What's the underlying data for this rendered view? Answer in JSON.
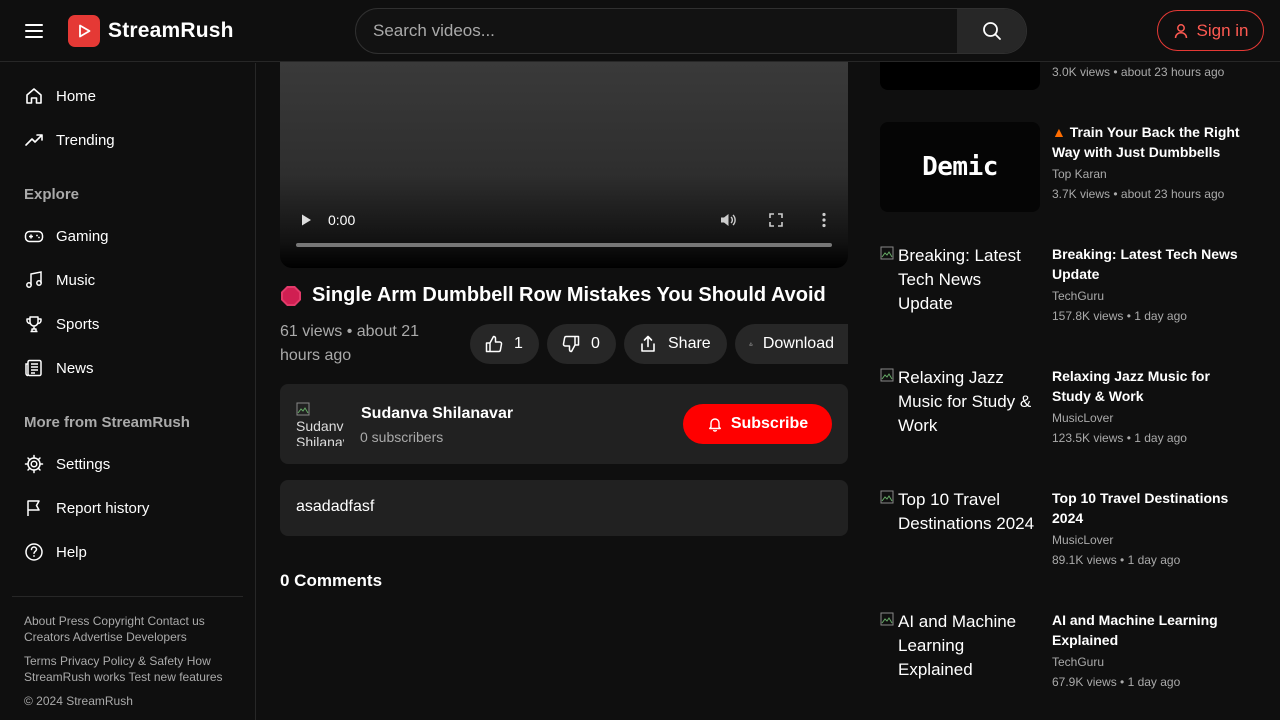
{
  "header": {
    "logo_text": "StreamRush",
    "search_placeholder": "Search videos...",
    "signin_label": "Sign in"
  },
  "sidebar": {
    "primary": [
      {
        "label": "Home",
        "icon": "home-icon"
      },
      {
        "label": "Trending",
        "icon": "trending-icon"
      }
    ],
    "explore_title": "Explore",
    "explore": [
      {
        "label": "Gaming",
        "icon": "gamepad-icon"
      },
      {
        "label": "Music",
        "icon": "music-note-icon"
      },
      {
        "label": "Sports",
        "icon": "trophy-icon"
      },
      {
        "label": "News",
        "icon": "newspaper-icon"
      }
    ],
    "more_title": "More from StreamRush",
    "more": [
      {
        "label": "Settings",
        "icon": "gear-icon"
      },
      {
        "label": "Report history",
        "icon": "flag-icon"
      },
      {
        "label": "Help",
        "icon": "help-circle-icon"
      }
    ],
    "footer": {
      "line1": [
        "About",
        "Press",
        "Copyright",
        "Contact us",
        "Creators",
        "Advertise",
        "Developers"
      ],
      "line2": [
        "Terms",
        "Privacy Policy & Safety",
        "How StreamRush works",
        "Test new features"
      ],
      "copyright": "© 2024 StreamRush"
    }
  },
  "player": {
    "time": "0:00"
  },
  "video": {
    "title": "Single Arm Dumbbell Row Mistakes You Should Avoid",
    "meta": "61 views • about 21 hours ago",
    "likes": "1",
    "dislikes": "0",
    "share_label": "Share",
    "download_label": "Download"
  },
  "channel": {
    "name": "Sudanva Shilanavar",
    "subscribers": "0 subscribers",
    "avatar_alt": "Sudanva Shilanavar",
    "subscribe_label": "Subscribe"
  },
  "description": "asadadfasf",
  "comments_title": "0 Comments",
  "recommended": [
    {
      "thumb_text": "",
      "title": "",
      "channel": "",
      "stats": "3.0K views • about 23 hours ago"
    },
    {
      "thumb_text": "Demic",
      "title": "Train Your Back the Right Way with Just Dumbbells",
      "channel": "Top Karan",
      "stats": "3.7K views • about 23 hours ago"
    },
    {
      "thumb_text": "Breaking: Latest Tech News Update",
      "title": "Breaking: Latest Tech News Update",
      "channel": "TechGuru",
      "stats": "157.8K views • 1 day ago"
    },
    {
      "thumb_text": "Relaxing Jazz Music for Study & Work",
      "title": "Relaxing Jazz Music for Study & Work",
      "channel": "MusicLover",
      "stats": "123.5K views • 1 day ago"
    },
    {
      "thumb_text": "Top 10 Travel Destinations 2024",
      "title": "Top 10 Travel Destinations 2024",
      "channel": "MusicLover",
      "stats": "89.1K views • 1 day ago"
    },
    {
      "thumb_text": "AI and Machine Learning Explained",
      "title": "AI and Machine Learning Explained",
      "channel": "TechGuru",
      "stats": "67.9K views • 1 day ago"
    }
  ],
  "colors": {
    "brand": "#e53935",
    "subscribe": "#ff0000",
    "background": "#0f0f0f",
    "surface": "#212121"
  }
}
